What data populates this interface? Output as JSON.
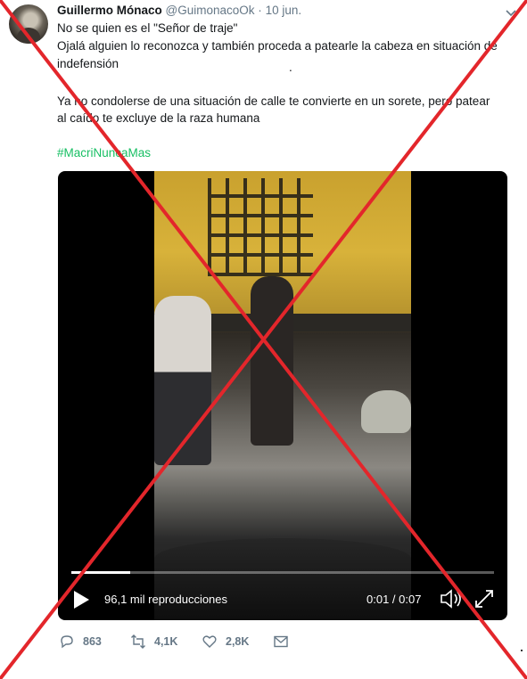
{
  "tweet": {
    "display_name": "Guillermo Mónaco",
    "handle": "@GuimonacoOk",
    "separator": "·",
    "date": "10 jun.",
    "lines": [
      "No se quien es el \"Señor de traje\"",
      "Ojalá alguien lo reconozca y también proceda a patearle la cabeza en situación de",
      "indefensión",
      ".",
      "Ya no condolerse de una situación de calle te convierte en un sorete, pero patear",
      "al caído te excluye de la raza humana"
    ],
    "hashtag": "#MacriNuncaMas"
  },
  "video": {
    "views": "96,1 mil reproducciones",
    "time": "0:01 / 0:07",
    "progress_fraction": 0.14
  },
  "actions": {
    "replies": "863",
    "retweets": "4,1K",
    "likes": "2,8K"
  },
  "colors": {
    "cross": "#e3262b",
    "hashtag": "#17bf63",
    "muted": "#657786"
  },
  "icons": [
    "caret-down-icon",
    "play-icon",
    "volume-icon",
    "fullscreen-icon",
    "reply-icon",
    "retweet-icon",
    "like-icon",
    "message-icon"
  ]
}
